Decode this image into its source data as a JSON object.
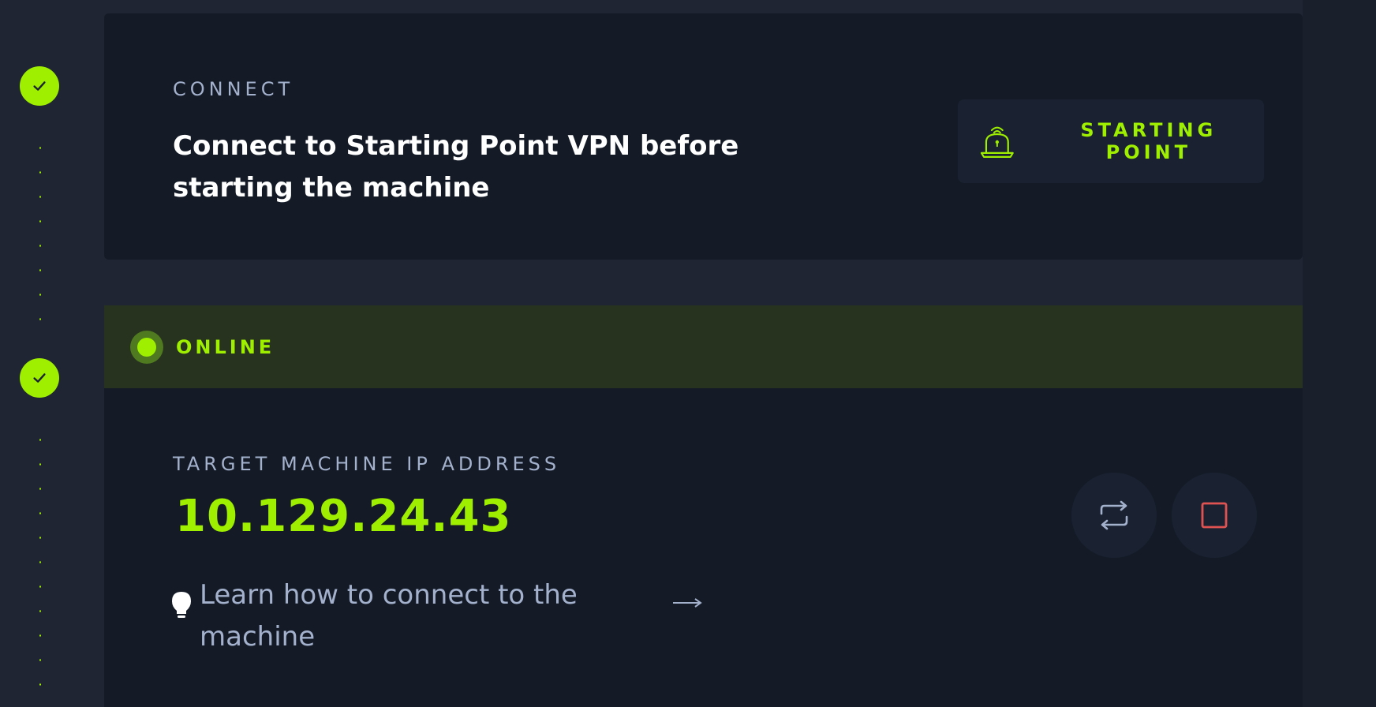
{
  "colors": {
    "accent": "#9fef00",
    "background": "#1f2533",
    "card": "#141b27",
    "status_bg": "#27331f",
    "muted_text": "#a4b1cd",
    "danger": "#e05252"
  },
  "steps": [
    {
      "state": "completed",
      "icon": "check-icon"
    },
    {
      "state": "completed",
      "icon": "check-icon"
    }
  ],
  "connect": {
    "eyebrow": "CONNECT",
    "heading": "Connect to Starting Point VPN before starting the machine",
    "button_label": "STARTING POINT",
    "button_icon": "vpn-laptop-icon"
  },
  "status": {
    "label": "ONLINE",
    "icon": "status-dot-icon"
  },
  "target": {
    "eyebrow": "TARGET MACHINE IP ADDRESS",
    "ip": "10.129.24.43",
    "reset_icon": "reset-icon",
    "stop_icon": "stop-icon",
    "learn_text": "Learn how to connect to the machine",
    "learn_icon": "lightbulb-icon",
    "arrow_icon": "arrow-right-icon"
  }
}
